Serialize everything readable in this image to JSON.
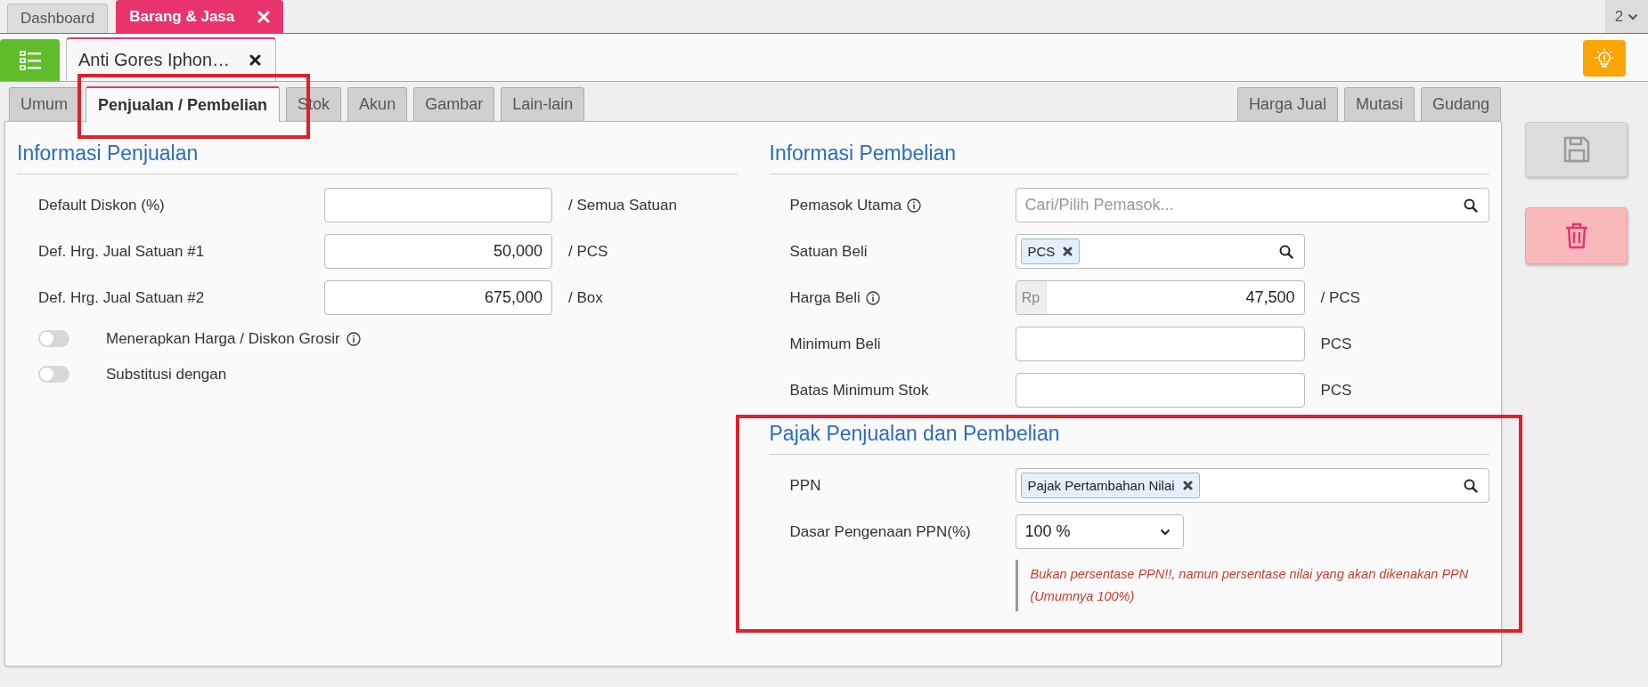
{
  "top_tabs": [
    {
      "label": "Dashboard",
      "selected": false,
      "closable": false
    },
    {
      "label": "Barang & Jasa",
      "selected": true,
      "closable": true
    }
  ],
  "tab_overflow": {
    "count": "2"
  },
  "document_tabs": [
    {
      "label": "Anti Gores Iphon…",
      "selected": true
    }
  ],
  "form_tabs_left": [
    {
      "label": "Umum",
      "selected": false
    },
    {
      "label": "Penjualan / Pembelian",
      "selected": true
    },
    {
      "label": "Stok",
      "selected": false
    },
    {
      "label": "Akun",
      "selected": false
    },
    {
      "label": "Gambar",
      "selected": false
    },
    {
      "label": "Lain-lain",
      "selected": false
    }
  ],
  "form_tabs_right": [
    {
      "label": "Harga Jual",
      "selected": false
    },
    {
      "label": "Mutasi",
      "selected": false
    },
    {
      "label": "Gudang",
      "selected": false
    }
  ],
  "sales_info": {
    "title": "Informasi Penjualan",
    "rows": [
      {
        "kind": "input",
        "label": "Default Diskon (%)",
        "suffix": "/ Semua Satuan"
      },
      {
        "kind": "input",
        "label": "Def. Hrg. Jual Satuan #1",
        "value": "50,000",
        "suffix": "/ PCS"
      },
      {
        "kind": "input",
        "label": "Def. Hrg. Jual Satuan #2",
        "value": "675,000",
        "suffix": "/ Box"
      },
      {
        "kind": "toggle",
        "label": "Menerapkan Harga / Diskon Grosir",
        "on": false,
        "info": true
      },
      {
        "kind": "toggle",
        "label": "Substitusi dengan",
        "on": false
      }
    ]
  },
  "purchase_info": {
    "title": "Informasi Pembelian",
    "rows": [
      {
        "kind": "search",
        "label": "Pemasok Utama",
        "info": true,
        "placeholder": "Cari/Pilih Pemasok..."
      },
      {
        "kind": "tags",
        "label": "Satuan Beli",
        "tags": [
          "PCS"
        ]
      },
      {
        "kind": "money",
        "label": "Harga Beli",
        "info": true,
        "prefix": "Rp",
        "value": "47,500",
        "suffix": "/ PCS"
      },
      {
        "kind": "input",
        "label": "Minimum Beli",
        "suffix": "PCS"
      },
      {
        "kind": "input",
        "label": "Batas Minimum Stok",
        "suffix": "PCS"
      }
    ]
  },
  "tax_info": {
    "title": "Pajak Penjualan dan Pembelian",
    "rows": [
      {
        "kind": "search",
        "label": "PPN",
        "tags": [
          "Pajak Pertambahan Nilai"
        ]
      },
      {
        "kind": "select",
        "label": "Dasar Pengenaan PPN(%)",
        "value": "100 %"
      },
      {
        "kind": "note",
        "text": "Bukan persentase PPN!!, namun persentase nilai yang akan dikenakan PPN (Umumnya 100%)"
      }
    ]
  },
  "actions": [
    {
      "kind": "save"
    },
    {
      "kind": "delete"
    }
  ]
}
